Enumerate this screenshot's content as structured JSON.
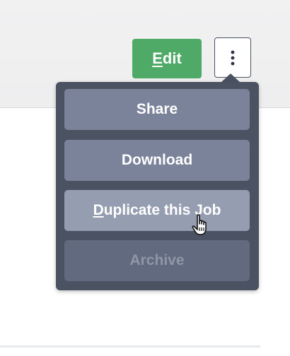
{
  "toolbar": {
    "edit_label": "Edit",
    "more_icon": "vertical-ellipsis-icon"
  },
  "menu": {
    "items": [
      {
        "label": "Share",
        "state": "normal"
      },
      {
        "label": "Download",
        "state": "normal"
      },
      {
        "label": "Duplicate this Job",
        "state": "hover"
      },
      {
        "label": "Archive",
        "state": "disabled"
      }
    ]
  },
  "colors": {
    "edit_button": "#4faa68",
    "menu_background": "#4b5262",
    "menu_item": "#7a8399",
    "menu_item_hover": "#959db0",
    "menu_item_disabled": "#616a7e"
  }
}
